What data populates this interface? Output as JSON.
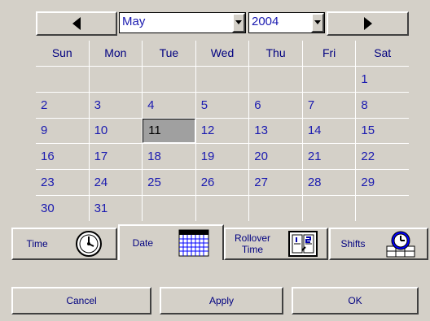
{
  "nav": {
    "prev_icon": "left-arrow-icon",
    "next_icon": "right-arrow-icon"
  },
  "month_select": {
    "value": "May"
  },
  "year_select": {
    "value": "2004"
  },
  "weekdays": [
    "Sun",
    "Mon",
    "Tue",
    "Wed",
    "Thu",
    "Fri",
    "Sat"
  ],
  "calendar": {
    "days": [
      "",
      "",
      "",
      "",
      "",
      "",
      "1",
      "2",
      "3",
      "4",
      "5",
      "6",
      "7",
      "8",
      "9",
      "10",
      "11",
      "12",
      "13",
      "14",
      "15",
      "16",
      "17",
      "18",
      "19",
      "20",
      "21",
      "22",
      "23",
      "24",
      "25",
      "26",
      "27",
      "28",
      "29",
      "30",
      "31",
      "",
      "",
      "",
      "",
      ""
    ],
    "selected": "11"
  },
  "tabs": [
    {
      "label": "Time",
      "icon": "clock-icon"
    },
    {
      "label": "Date",
      "icon": "calendar-icon"
    },
    {
      "label_line1": "Rollover",
      "label_line2": "Time",
      "icon": "rollover-icon"
    },
    {
      "label": "Shifts",
      "icon": "shifts-icon"
    }
  ],
  "buttons": {
    "cancel": "Cancel",
    "apply": "Apply",
    "ok": "OK"
  }
}
